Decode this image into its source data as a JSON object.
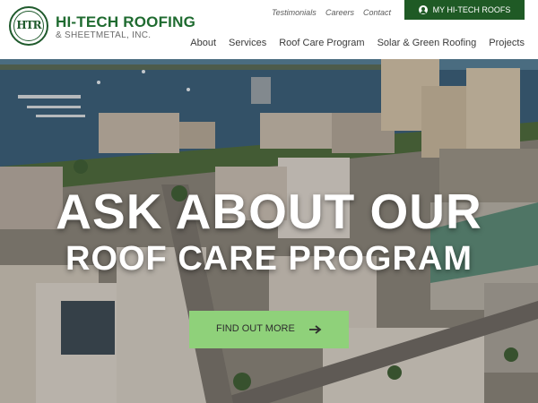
{
  "brand": {
    "logo_icon": "company-seal-logo",
    "seal_text": "HTR",
    "name": "HI-TECH ROOFING",
    "subtitle": "& SHEETMETAL, INC."
  },
  "utility_links": [
    "Testimonials",
    "Careers",
    "Contact"
  ],
  "account_button": {
    "icon": "user-circle-icon",
    "label": "MY HI-TECH ROOFS"
  },
  "nav": [
    "About",
    "Services",
    "Roof Care Program",
    "Solar & Green Roofing",
    "Projects"
  ],
  "hero": {
    "background": "aerial-city-waterfront-photo",
    "headline": "ASK ABOUT OUR",
    "subheadline": "ROOF CARE PROGRAM",
    "cta_label": "FIND OUT MORE",
    "cta_icon": "arrow-right-icon"
  },
  "colors": {
    "brand_green": "#1f6b30",
    "account_button_bg": "#1f5a25",
    "cta_bg": "#8fd17a",
    "text_gray": "#5a5a5a"
  }
}
